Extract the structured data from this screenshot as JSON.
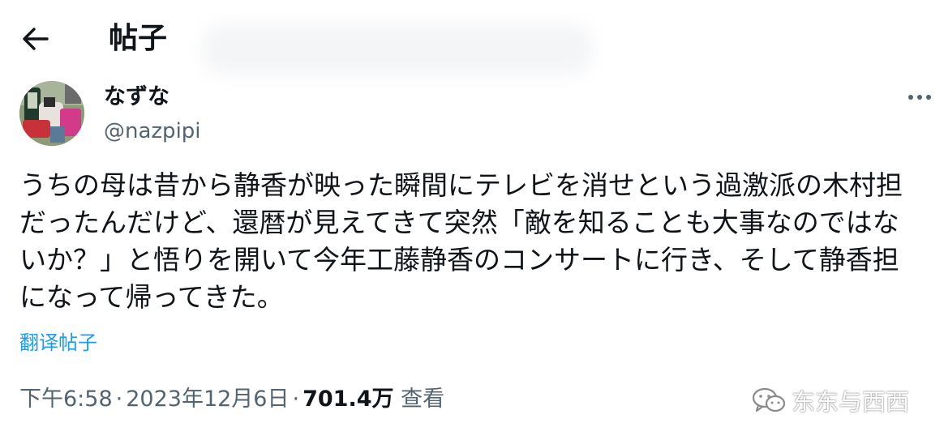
{
  "header": {
    "back_icon": "arrow-left-icon",
    "title": "帖子"
  },
  "post": {
    "author": {
      "display_name": "なずな",
      "handle": "@nazpipi",
      "avatar_icon": "avatar"
    },
    "more_icon": "more-horizontal-icon",
    "text_lines": [
      "うちの母は昔から静香が映った瞬間にテレビを消せという過激派の木村担",
      "だったんだけど、還暦が見えてきて突然「敵を知ることも大事なのではな",
      "いか？」と悟りを開いて今年工藤静香のコンサートに行き、そして静香担",
      "になって帰ってきた。"
    ],
    "translate_label": "翻译帖子",
    "time": "下午6:58",
    "separator": "·",
    "date": "2023年12月6日",
    "views_count": "701.4万",
    "views_label": "查看"
  },
  "watermark": {
    "icon": "wechat-icon",
    "text": "东东与西西"
  },
  "colors": {
    "text_primary": "#0f1419",
    "text_secondary": "#536471",
    "link": "#1d9bf0",
    "background": "#ffffff"
  }
}
